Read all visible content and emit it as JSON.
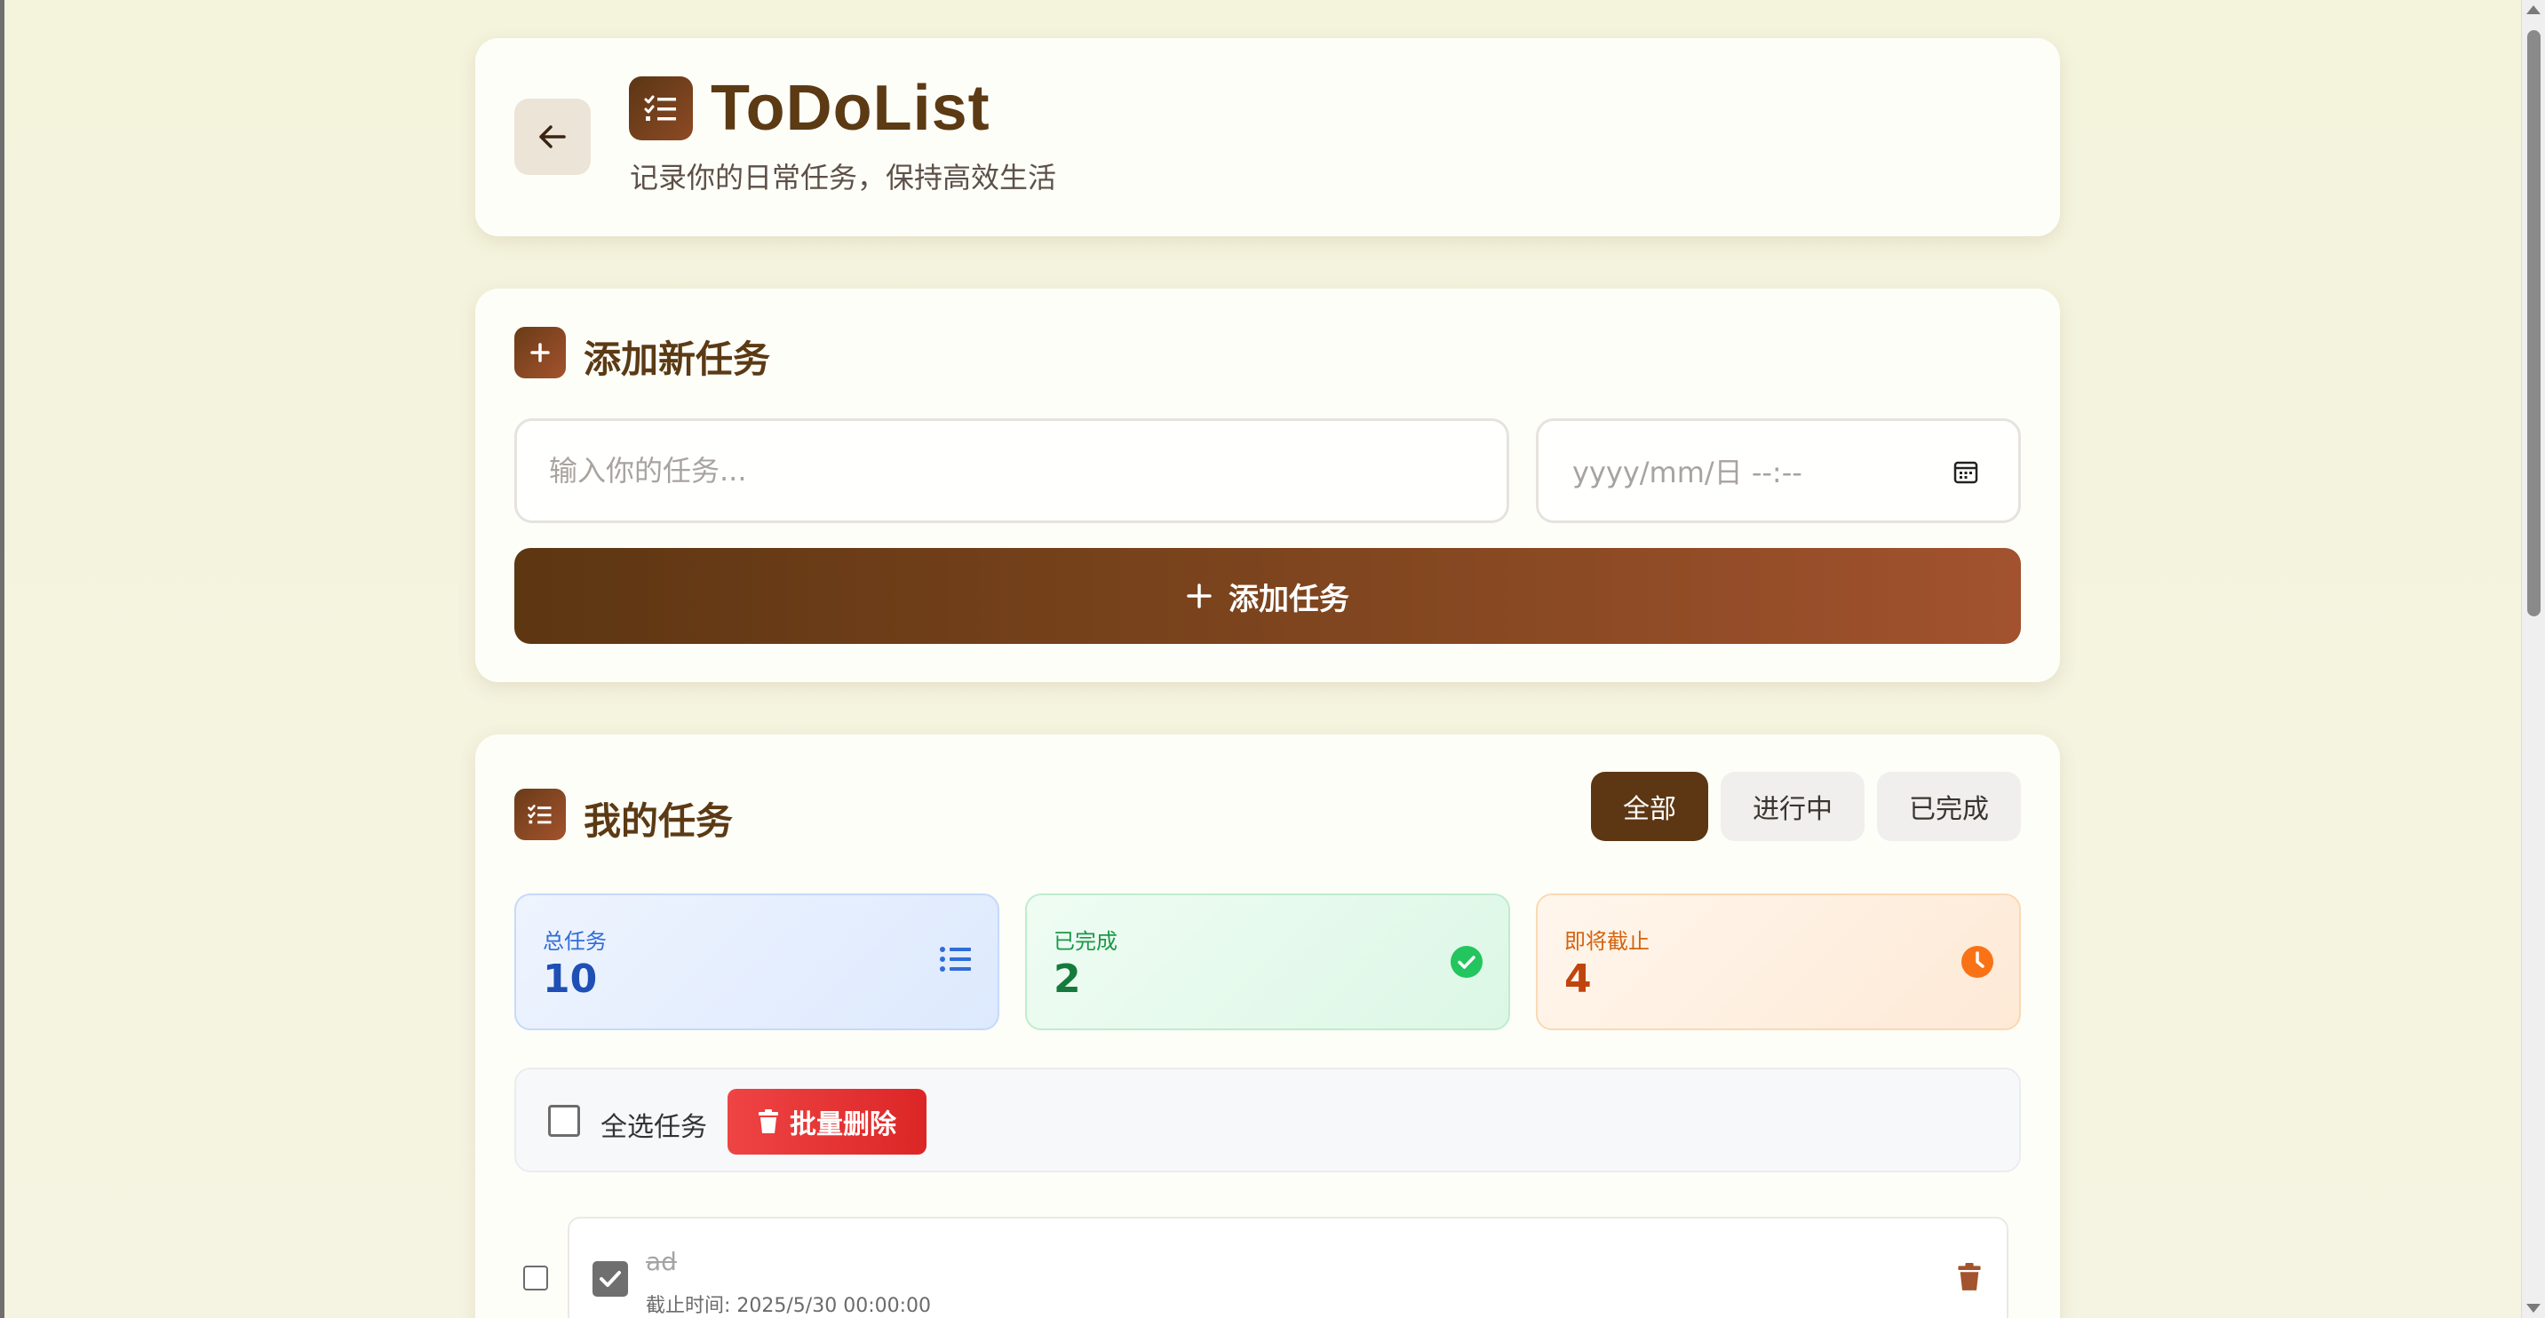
{
  "header": {
    "back_icon": "arrow-left-icon",
    "app_icon": "list-check-icon",
    "title": "ToDoList",
    "subtitle": "记录你的日常任务，保持高效生活"
  },
  "add_section": {
    "icon": "plus-icon",
    "title": "添加新任务",
    "task_placeholder": "输入你的任务...",
    "date_placeholder": "yyyy/mm/日 --:--",
    "add_button_label": "添加任务"
  },
  "tasks_section": {
    "icon": "list-check-icon",
    "title": "我的任务",
    "filters": [
      {
        "label": "全部",
        "active": true
      },
      {
        "label": "进行中",
        "active": false
      },
      {
        "label": "已完成",
        "active": false
      }
    ],
    "stats": {
      "total": {
        "label": "总任务",
        "value": "10",
        "icon": "list-icon"
      },
      "completed": {
        "label": "已完成",
        "value": "2",
        "icon": "check-circle-icon"
      },
      "due_soon": {
        "label": "即将截止",
        "value": "4",
        "icon": "clock-icon"
      }
    },
    "bulk": {
      "select_all_label": "全选任务",
      "delete_label": "批量删除"
    },
    "tasks": [
      {
        "text": "ad",
        "deadline": "截止时间: 2025/5/30 00:00:00",
        "completed": true
      }
    ]
  },
  "colors": {
    "brand": "#5b3a14",
    "accent_gradient_end": "#a3532d",
    "danger": "#dc2626"
  }
}
